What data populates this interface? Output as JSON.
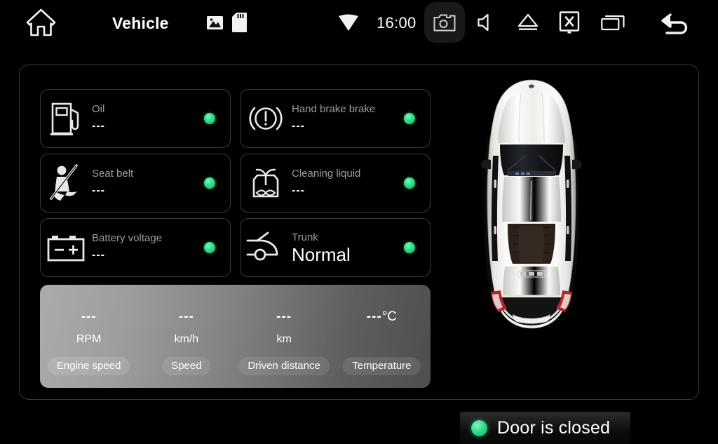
{
  "statusbar": {
    "title": "Vehicle",
    "clock": "16:00",
    "icons": {
      "home": "home-icon",
      "gallery": "gallery-icon",
      "sdcard": "sd-card-icon",
      "wifi": "wifi-signal-icon",
      "camera": "screenshot-camera-icon",
      "volume": "volume-mute-icon",
      "eject": "eject-icon",
      "screenoff": "screen-off-icon",
      "recent": "recent-apps-icon",
      "back": "back-arrow-icon"
    }
  },
  "colors": {
    "status_green": "#2ada84",
    "panel_border": "#3a3a3a",
    "label_gray": "#9d9d9d",
    "background": "#000000"
  },
  "cards": [
    {
      "icon": "fuel-pump-icon",
      "label": "Oil",
      "value": "---",
      "status": "ok",
      "big": false
    },
    {
      "icon": "hand-brake-icon",
      "label": "Hand brake brake",
      "value": "---",
      "status": "ok",
      "big": false
    },
    {
      "icon": "seat-belt-icon",
      "label": "Seat belt",
      "value": "---",
      "status": "ok",
      "big": false
    },
    {
      "icon": "washer-fluid-icon",
      "label": "Cleaning liquid",
      "value": "---",
      "status": "ok",
      "big": false
    },
    {
      "icon": "battery-icon",
      "label": "Battery voltage",
      "value": "---",
      "status": "ok",
      "big": false
    },
    {
      "icon": "trunk-open-icon",
      "label": "Trunk",
      "value": "Normal",
      "status": "ok",
      "big": true
    }
  ],
  "metrics": [
    {
      "value": "---",
      "unit_suffix": "",
      "unit": "RPM",
      "label": "Engine speed"
    },
    {
      "value": "---",
      "unit_suffix": "",
      "unit": "km/h",
      "label": "Speed"
    },
    {
      "value": "---",
      "unit_suffix": "",
      "unit": "km",
      "label": "Driven distance"
    },
    {
      "value": "---",
      "unit_suffix": "°C",
      "unit": "",
      "label": "Temperature"
    }
  ],
  "car": {
    "image_name": "car-top-view-white-sedan",
    "door_status": "Door is closed",
    "door_status_ok": true
  }
}
